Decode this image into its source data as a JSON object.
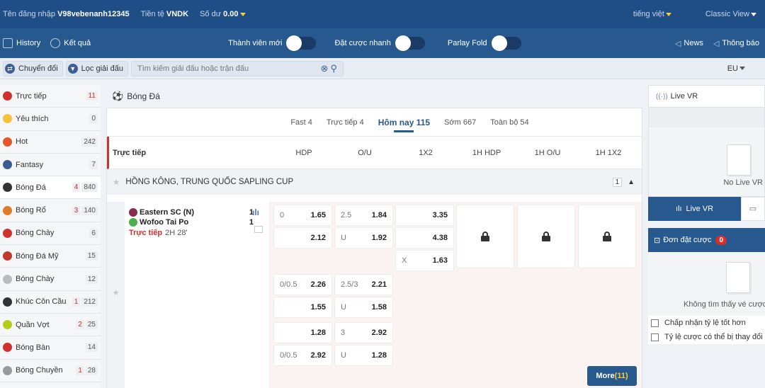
{
  "topbar": {
    "login_label": "Tên đăng nhập",
    "username": "V98vebenanh12345",
    "currency_label": "Tiền tệ",
    "currency": "VNDK",
    "balance_label": "Số dư",
    "balance": "0.00",
    "language": "tiếng việt",
    "view": "Classic View"
  },
  "navbar": {
    "history": "History",
    "results": "Kết quả",
    "new_member": "Thành viên mới",
    "quick_bet": "Đặt cược nhanh",
    "parlay_fold": "Parlay Fold",
    "news": "News",
    "notice": "Thông báo"
  },
  "filterbar": {
    "switch": "Chuyển đổi",
    "league_filter": "Lọc giải đấu",
    "search_placeholder": "Tìm kiếm giải đấu hoặc trận đấu",
    "odds_format": "EU"
  },
  "sidebar": {
    "items": [
      {
        "label": "Trực tiếp",
        "count": "11",
        "live": "",
        "color": "#d0312d"
      },
      {
        "label": "Yêu thích",
        "count": "0",
        "live": "",
        "color": "#f5c13b"
      },
      {
        "label": "Hot",
        "count": "242",
        "live": "",
        "color": "#e4572e"
      },
      {
        "label": "Fantasy",
        "count": "7",
        "live": "",
        "color": "#3b5b92"
      },
      {
        "label": "Bóng Đá",
        "count": "840",
        "live": "4",
        "color": "#333333"
      },
      {
        "label": "Bóng Rổ",
        "count": "140",
        "live": "3",
        "color": "#e07b2a"
      },
      {
        "label": "Bóng Chày",
        "count": "6",
        "live": "",
        "color": "#d0312d"
      },
      {
        "label": "Bóng Đá Mỹ",
        "count": "15",
        "live": "",
        "color": "#c0392b"
      },
      {
        "label": "Bóng Chày",
        "count": "12",
        "live": "",
        "color": "#bbbbbb"
      },
      {
        "label": "Khúc Côn Cầu",
        "count": "212",
        "live": "1",
        "color": "#333333"
      },
      {
        "label": "Quần Vợt",
        "count": "25",
        "live": "2",
        "color": "#b5cc18"
      },
      {
        "label": "Bóng Bàn",
        "count": "14",
        "live": "",
        "color": "#d0312d"
      },
      {
        "label": "Bóng Chuyền",
        "count": "28",
        "live": "1",
        "color": "#999999"
      }
    ]
  },
  "main": {
    "sport_title": "Bóng Đá",
    "tabs": [
      "Fast 4",
      "Trực tiếp 4",
      "Hôm nay 115",
      "Sớm 667",
      "Toàn bộ 54"
    ],
    "active_tab": 2,
    "section_label": "Trực tiếp",
    "columns": [
      "HDP",
      "O/U",
      "1X2",
      "1H HDP",
      "1H O/U",
      "1H 1X2"
    ],
    "league": "HỒNG KÔNG, TRUNG QUỐC SAPLING CUP",
    "league_count": "1",
    "match": {
      "home": "Eastern SC (N)",
      "away": "Wofoo Tai Po",
      "home_score": "1",
      "away_score": "1",
      "live_label": "Trực tiếp",
      "time": "2H 28'"
    },
    "odds_rows": [
      {
        "hdp_h": "0",
        "hdp_v": "1.65",
        "ou_h": "2.5",
        "ou_v": "1.84",
        "x12_h": "",
        "x12_v": "3.35"
      },
      {
        "hdp_h": "",
        "hdp_v": "2.12",
        "ou_h": "U",
        "ou_v": "1.92",
        "x12_h": "",
        "x12_v": "4.38"
      },
      {
        "hdp_h": "",
        "hdp_v": "",
        "ou_h": "",
        "ou_v": "",
        "x12_h": "X",
        "x12_v": "1.63"
      },
      {
        "hdp_h": "0/0.5",
        "hdp_v": "2.26",
        "ou_h": "2.5/3",
        "ou_v": "2.21",
        "x12_h": "",
        "x12_v": ""
      },
      {
        "hdp_h": "",
        "hdp_v": "1.55",
        "ou_h": "U",
        "ou_v": "1.58",
        "x12_h": "",
        "x12_v": ""
      },
      {
        "hdp_h": "",
        "hdp_v": "1.28",
        "ou_h": "3",
        "ou_v": "2.92",
        "x12_h": "",
        "x12_v": ""
      },
      {
        "hdp_h": "0/0.5",
        "hdp_v": "2.92",
        "ou_h": "U",
        "ou_v": "1.28",
        "x12_h": "",
        "x12_v": ""
      }
    ],
    "more_label": "More",
    "more_count": "(11)"
  },
  "right": {
    "live_vr": "Live VR",
    "no_live_vr": "No Live VR",
    "live_vr_tab": "Live VR",
    "betslip": "Đơn đặt cược",
    "betslip_count": "0",
    "no_bets": "Không tìm thấy vé cược",
    "accept_better": "Chấp nhận tỷ lệ tốt hơn",
    "odds_may_change": "Tỷ lệ cược có thể bị thay đổi"
  }
}
